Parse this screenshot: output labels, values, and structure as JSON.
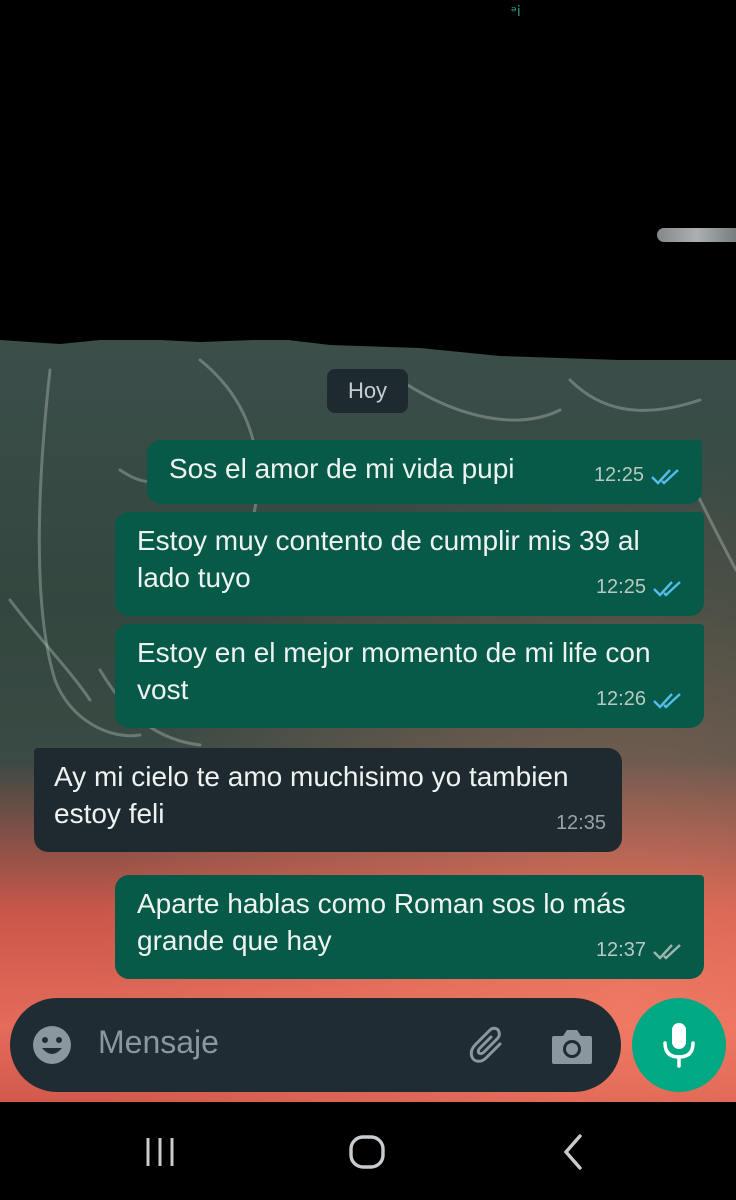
{
  "chat": {
    "date_label": "Hoy",
    "messages": [
      {
        "direction": "out",
        "text": "Sos el amor de mi vida pupi",
        "time": "12:25",
        "status": "read"
      },
      {
        "direction": "out",
        "text": "Estoy muy contento de cumplir mis 39 al lado tuyo",
        "time": "12:25",
        "status": "read"
      },
      {
        "direction": "out",
        "text": "Estoy en el mejor momento de mi life con vost",
        "time": "12:26",
        "status": "read"
      },
      {
        "direction": "in",
        "text": "Ay mi cielo te amo muchisimo yo tambien estoy feli",
        "time": "12:35"
      },
      {
        "direction": "out",
        "text": "Aparte hablas como Roman sos lo más grande que hay",
        "time": "12:37",
        "status": "delivered"
      }
    ]
  },
  "composer": {
    "placeholder": "Mensaje",
    "icons": [
      "emoji-icon",
      "attachment-icon",
      "camera-icon",
      "microphone-icon"
    ]
  },
  "navbar": {
    "icons": [
      "recents-icon",
      "home-icon",
      "back-icon"
    ]
  },
  "colors": {
    "outgoing_bubble": "#065a47",
    "incoming_bubble": "#1f2a30",
    "read_tick": "#53bdeb",
    "delivered_tick": "#9fb5af",
    "accent": "#00a884"
  }
}
